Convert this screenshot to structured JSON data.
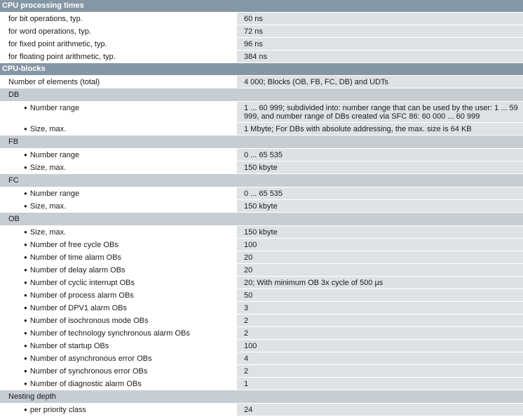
{
  "sections": [
    {
      "title": "CPU processing times",
      "rows": [
        {
          "label": "for bit operations, typ.",
          "value": "60 ns"
        },
        {
          "label": "for word operations, typ.",
          "value": "72 ns"
        },
        {
          "label": "for fixed point arithmetic, typ.",
          "value": "96 ns"
        },
        {
          "label": "for floating point arithmetic, typ.",
          "value": "384 ns"
        }
      ]
    },
    {
      "title": "CPU-blocks",
      "rows": [
        {
          "label": "Number of elements (total)",
          "value": "4 000; Blocks (OB, FB, FC, DB) and UDTs"
        }
      ],
      "groups": [
        {
          "title": "DB",
          "rows": [
            {
              "label": "Number range",
              "value": "1 ... 60 999; subdivided into: number range that can be used by the user: 1 ... 59 999, and number range of DBs created via SFC 86: 60 000 ... 60 999"
            },
            {
              "label": "Size, max.",
              "value": "1 Mbyte; For DBs with absolute addressing, the max. size is 64 KB"
            }
          ]
        },
        {
          "title": "FB",
          "rows": [
            {
              "label": "Number range",
              "value": "0 ... 65 535"
            },
            {
              "label": "Size, max.",
              "value": "150 kbyte"
            }
          ]
        },
        {
          "title": "FC",
          "rows": [
            {
              "label": "Number range",
              "value": "0 ... 65 535"
            },
            {
              "label": "Size, max.",
              "value": "150 kbyte"
            }
          ]
        },
        {
          "title": "OB",
          "rows": [
            {
              "label": "Size, max.",
              "value": "150 kbyte"
            },
            {
              "label": "Number of free cycle OBs",
              "value": "100"
            },
            {
              "label": "Number of time alarm OBs",
              "value": "20"
            },
            {
              "label": "Number of delay alarm OBs",
              "value": "20"
            },
            {
              "label": "Number of cyclic interrupt OBs",
              "value": "20; With minimum OB 3x cycle of 500 µs"
            },
            {
              "label": "Number of process alarm OBs",
              "value": "50"
            },
            {
              "label": "Number of DPV1 alarm OBs",
              "value": "3"
            },
            {
              "label": "Number of isochronous mode OBs",
              "value": "2"
            },
            {
              "label": "Number of technology synchronous alarm OBs",
              "value": "2"
            },
            {
              "label": "Number of startup OBs",
              "value": "100"
            },
            {
              "label": "Number of asynchronous error OBs",
              "value": "4"
            },
            {
              "label": "Number of synchronous error OBs",
              "value": "2"
            },
            {
              "label": "Number of diagnostic alarm OBs",
              "value": "1"
            }
          ]
        },
        {
          "title": "Nesting depth",
          "rows": [
            {
              "label": "per priority class",
              "value": "24"
            }
          ]
        }
      ]
    }
  ]
}
